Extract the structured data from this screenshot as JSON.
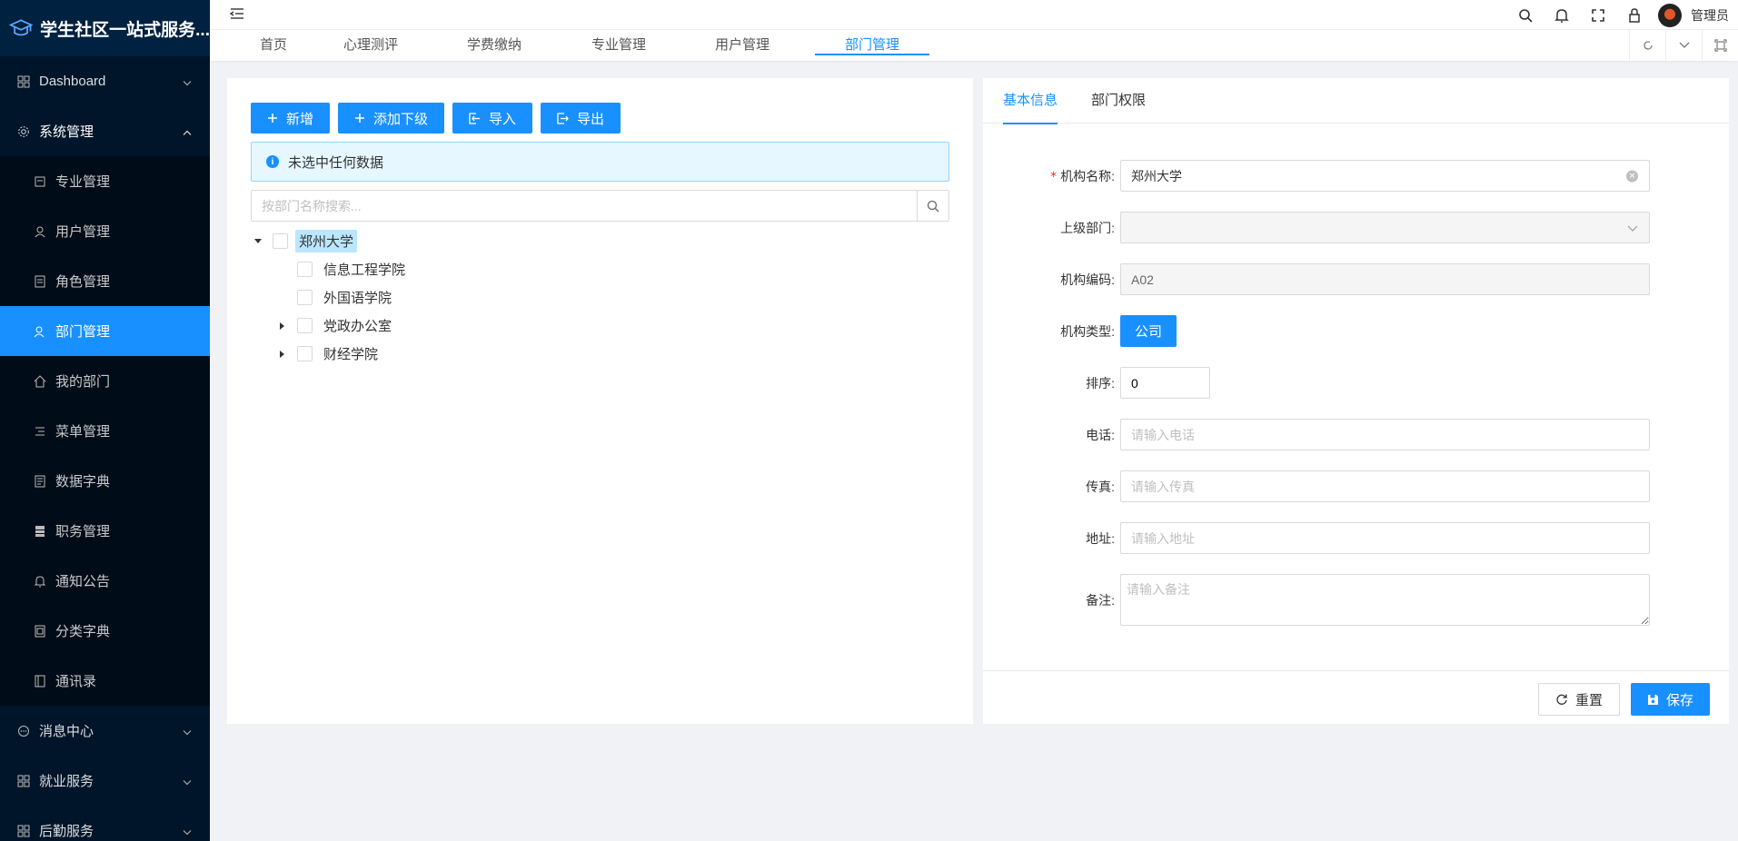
{
  "app": {
    "title": "学生社区一站式服务..."
  },
  "sidebar": {
    "groups": [
      {
        "label": "Dashboard",
        "icon": "dashboard-icon"
      },
      {
        "label": "系统管理",
        "icon": "gear-icon"
      }
    ],
    "items": [
      {
        "label": "专业管理",
        "icon": "major-icon"
      },
      {
        "label": "用户管理",
        "icon": "user-icon"
      },
      {
        "label": "角色管理",
        "icon": "role-icon"
      },
      {
        "label": "部门管理",
        "icon": "department-icon"
      },
      {
        "label": "我的部门",
        "icon": "home-icon"
      },
      {
        "label": "菜单管理",
        "icon": "menu-list-icon"
      },
      {
        "label": "数据字典",
        "icon": "dictionary-icon"
      },
      {
        "label": "职务管理",
        "icon": "position-icon"
      },
      {
        "label": "通知公告",
        "icon": "bell-icon"
      },
      {
        "label": "分类字典",
        "icon": "category-icon"
      },
      {
        "label": "通讯录",
        "icon": "contacts-icon"
      }
    ],
    "bottom_groups": [
      {
        "label": "消息中心",
        "icon": "message-icon"
      },
      {
        "label": "就业服务",
        "icon": "employment-icon"
      },
      {
        "label": "后勤服务",
        "icon": "logistics-icon"
      }
    ],
    "active_item": "部门管理",
    "colors": {
      "bg": "#001529",
      "sub_bg": "#000c17",
      "active": "#1890ff"
    }
  },
  "header": {
    "username": "管理员"
  },
  "tabs": [
    "首页",
    "心理测评",
    "学费缴纳",
    "专业管理",
    "用户管理",
    "部门管理"
  ],
  "active_tab": "部门管理",
  "left_panel": {
    "buttons": {
      "add": "新增",
      "add_child": "添加下级",
      "import": "导入",
      "export": "导出"
    },
    "alert": "未选中任何数据",
    "search_placeholder": "按部门名称搜索...",
    "tree": {
      "root": "郑州大学",
      "children": [
        "信息工程学院",
        "外国语学院",
        "党政办公室",
        "财经学院"
      ]
    }
  },
  "right_panel": {
    "tabs": [
      "基本信息",
      "部门权限"
    ],
    "form": {
      "name_label": "机构名称:",
      "name_value": "郑州大学",
      "parent_label": "上级部门:",
      "parent_value": "",
      "code_label": "机构编码:",
      "code_value": "A02",
      "type_label": "机构类型:",
      "type_value": "公司",
      "order_label": "排序:",
      "order_value": "0",
      "phone_label": "电话:",
      "phone_placeholder": "请输入电话",
      "fax_label": "传真:",
      "fax_placeholder": "请输入传真",
      "address_label": "地址:",
      "address_placeholder": "请输入地址",
      "remark_label": "备注:",
      "remark_placeholder": "请输入备注"
    },
    "buttons": {
      "reset": "重置",
      "save": "保存"
    }
  },
  "colors": {
    "primary": "#1890ff",
    "page_bg": "#f0f2f5",
    "required": "#f5222d"
  }
}
